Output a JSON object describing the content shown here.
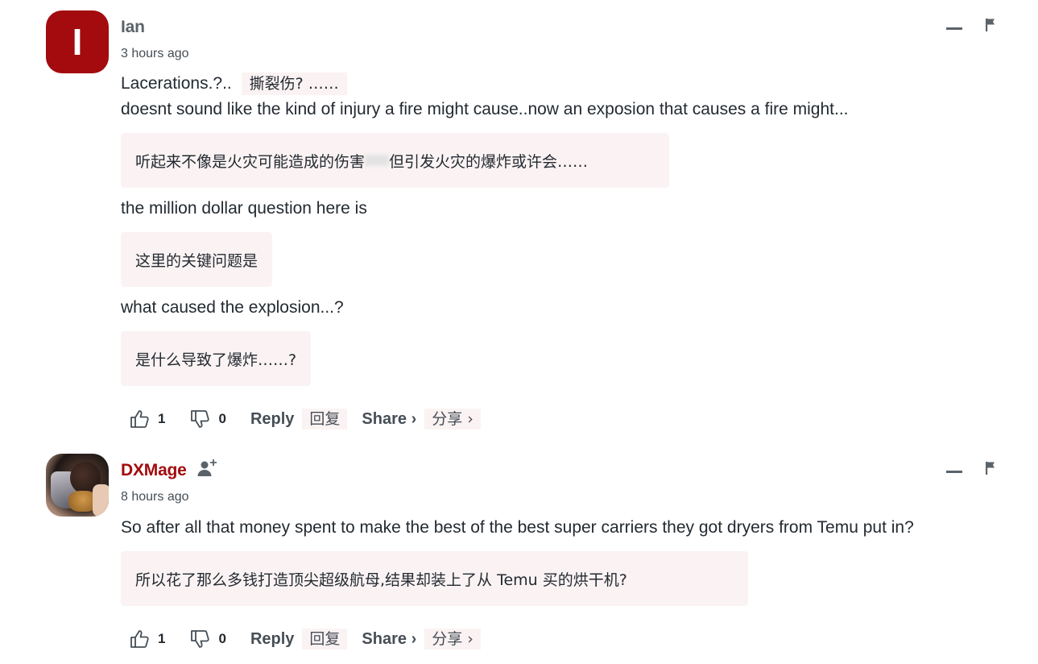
{
  "comments": [
    {
      "author": "Ian",
      "avatar_letter": "I",
      "timestamp": "3 hours ago",
      "line1_text": "Lacerations.?..",
      "line1_trans": "撕裂伤? ……",
      "para1": "doesnt sound like the kind of injury a fire might cause..now an exposion that causes a fire might...",
      "para1_trans_a": "听起来不像是火灾可能造成的伤害",
      "para1_trans_b": "但引发火灾的爆炸或许会……",
      "para2": "the million dollar question here is",
      "para2_trans": "这里的关键问题是",
      "para3": "what caused the explosion...?",
      "para3_trans": "是什么导致了爆炸……?",
      "likes": "1",
      "dislikes": "0",
      "reply_label": "Reply",
      "reply_trans": "回复",
      "share_label": "Share ›",
      "share_trans": "分享 ›"
    },
    {
      "author": "DXMage",
      "timestamp": "8 hours ago",
      "para1": "So after all that money spent to make the best of the best super carriers they got dryers from Temu put in?",
      "para1_trans": "所以花了那么多钱打造顶尖超级航母,结果却装上了从 Temu 买的烘干机?",
      "likes": "1",
      "dislikes": "0",
      "reply_label": "Reply",
      "reply_trans": "回复",
      "share_label": "Share ›",
      "share_trans": "分享 ›"
    }
  ],
  "colors": {
    "accent": "#a30b0e",
    "translation_bg": "#fbf3f3",
    "text": "#232a31",
    "muted": "#464e56"
  }
}
